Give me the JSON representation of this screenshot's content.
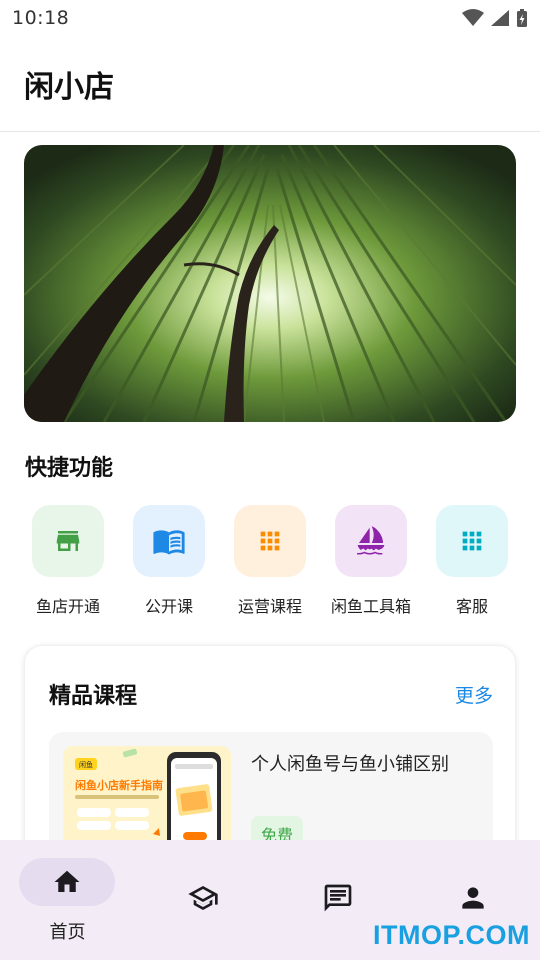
{
  "status_bar": {
    "time": "10:18",
    "icons": [
      "wifi-icon",
      "signal-icon",
      "battery-charging-icon"
    ]
  },
  "header": {
    "title": "闲小店"
  },
  "hero": {
    "image": "bamboo-forest-photo"
  },
  "quick": {
    "title": "快捷功能",
    "items": [
      {
        "label": "鱼店开通",
        "icon": "store-icon",
        "bg": "#e8f5e9",
        "fg": "#43a047"
      },
      {
        "label": "公开课",
        "icon": "book-icon",
        "bg": "#e3f0fd",
        "fg": "#1e88e5"
      },
      {
        "label": "运营课程",
        "icon": "apps-grid-icon",
        "bg": "#fff0dd",
        "fg": "#fb8c00"
      },
      {
        "label": "闲鱼工具箱",
        "icon": "sailboat-icon",
        "bg": "#f2e3f6",
        "fg": "#8e24aa"
      },
      {
        "label": "客服",
        "icon": "apps-grid-icon",
        "bg": "#e0f7fa",
        "fg": "#00acc1"
      }
    ]
  },
  "courses": {
    "title": "精品课程",
    "more": "更多",
    "items": [
      {
        "name": "个人闲鱼号与鱼小铺区别",
        "badge": "免费",
        "thumb_title": "闲鱼小店新手指南"
      }
    ]
  },
  "bottom_nav": {
    "items": [
      {
        "label": "首页",
        "icon": "home-icon",
        "active": true
      },
      {
        "label": "",
        "icon": "school-icon"
      },
      {
        "label": "",
        "icon": "message-icon"
      },
      {
        "label": "",
        "icon": "person-icon"
      }
    ]
  },
  "watermark": "ITMOP.COM",
  "colors": {
    "accent": "#1e88e5",
    "nav_bg": "#f3ecf6",
    "nav_active_pill": "#e5dcef",
    "free_badge": "#3fa84a"
  }
}
